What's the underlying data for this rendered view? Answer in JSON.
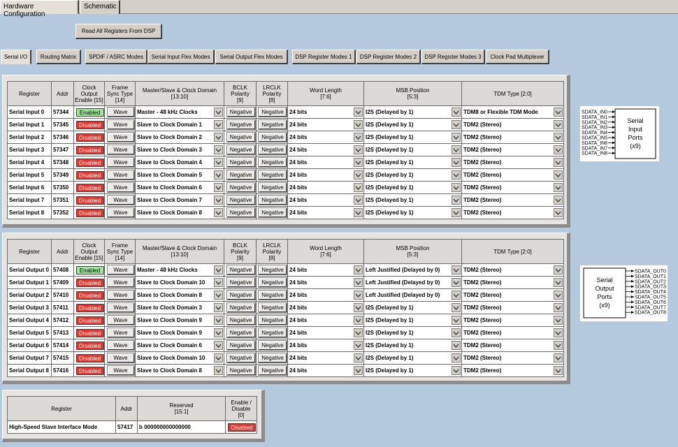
{
  "window": {
    "tabs": [
      {
        "label": "Hardware Configuration",
        "active": true
      },
      {
        "label": "Schematic",
        "active": false
      }
    ],
    "read_button": "Read All Registers From DSP"
  },
  "subtabs": [
    {
      "label": "Serial I/O",
      "active": true
    },
    {
      "label": "Routing Matrix",
      "active": false
    },
    {
      "label": "SPDIF / ASRC Modes",
      "active": false
    },
    {
      "label": "Serial Input Flex Modes",
      "active": false
    },
    {
      "label": "Serial Output Flex Modes",
      "active": false
    },
    {
      "label": "DSP Register Modes 1",
      "active": false
    },
    {
      "label": "DSP Register Modes 2",
      "active": false
    },
    {
      "label": "DSP Register Modes 3",
      "active": false
    },
    {
      "label": "Clock Pad Multiplexer",
      "active": false
    }
  ],
  "columns": {
    "register": "Register",
    "addr": "Addr",
    "clock_enable": [
      "Clock",
      "Output",
      "Enable [15]"
    ],
    "frame_sync": [
      "Frame",
      "Sync Type",
      "[14]"
    ],
    "master_slave": [
      "Master/Slave & Clock Domain",
      "[13:10]"
    ],
    "bclk": [
      "BCLK",
      "Polarity",
      "[9]"
    ],
    "lrclk": [
      "LRCLK",
      "Polarity",
      "[8]"
    ],
    "word_length": [
      "Word Length",
      "[7:6]"
    ],
    "msb": [
      "MSB Position",
      "[5:3]"
    ],
    "tdm": [
      "TDM Type [2:0]"
    ]
  },
  "inputs": [
    {
      "name": "Serial Input 0",
      "addr": "57344",
      "enable": "Enabled",
      "sync": "Wave",
      "domain": "Master - 48 kHz Clocks",
      "bclk": "Negative",
      "lrclk": "Negative",
      "word": "24 bits",
      "msb": "I2S (Delayed by 1)",
      "tdm": "TDM8 or Flexible TDM Mode"
    },
    {
      "name": "Serial Input 1",
      "addr": "57345",
      "enable": "Disabled",
      "sync": "Wave",
      "domain": "Slave to Clock Domain 1",
      "bclk": "Negative",
      "lrclk": "Negative",
      "word": "24 bits",
      "msb": "I2S (Delayed by 1)",
      "tdm": "TDM2 (Stereo)"
    },
    {
      "name": "Serial Input 2",
      "addr": "57346",
      "enable": "Disabled",
      "sync": "Wave",
      "domain": "Slave to Clock Domain 2",
      "bclk": "Negative",
      "lrclk": "Negative",
      "word": "24 bits",
      "msb": "I2S (Delayed by 1)",
      "tdm": "TDM2 (Stereo)"
    },
    {
      "name": "Serial Input 3",
      "addr": "57347",
      "enable": "Disabled",
      "sync": "Wave",
      "domain": "Slave to Clock Domain 3",
      "bclk": "Negative",
      "lrclk": "Negative",
      "word": "24 bits",
      "msb": "I2S (Delayed by 1)",
      "tdm": "TDM2 (Stereo)"
    },
    {
      "name": "Serial Input 4",
      "addr": "57348",
      "enable": "Disabled",
      "sync": "Wave",
      "domain": "Slave to Clock Domain 4",
      "bclk": "Negative",
      "lrclk": "Negative",
      "word": "24 bits",
      "msb": "I2S (Delayed by 1)",
      "tdm": "TDM2 (Stereo)"
    },
    {
      "name": "Serial Input 5",
      "addr": "57349",
      "enable": "Disabled",
      "sync": "Wave",
      "domain": "Slave to Clock Domain 5",
      "bclk": "Negative",
      "lrclk": "Negative",
      "word": "24 bits",
      "msb": "I2S (Delayed by 1)",
      "tdm": "TDM2 (Stereo)"
    },
    {
      "name": "Serial Input 6",
      "addr": "57350",
      "enable": "Disabled",
      "sync": "Wave",
      "domain": "Slave to Clock Domain 6",
      "bclk": "Negative",
      "lrclk": "Negative",
      "word": "24 bits",
      "msb": "I2S (Delayed by 1)",
      "tdm": "TDM2 (Stereo)"
    },
    {
      "name": "Serial Input 7",
      "addr": "57351",
      "enable": "Disabled",
      "sync": "Wave",
      "domain": "Slave to Clock Domain 7",
      "bclk": "Negative",
      "lrclk": "Negative",
      "word": "24 bits",
      "msb": "I2S (Delayed by 1)",
      "tdm": "TDM2 (Stereo)"
    },
    {
      "name": "Serial Input 8",
      "addr": "57352",
      "enable": "Disabled",
      "sync": "Wave",
      "domain": "Slave to Clock Domain 8",
      "bclk": "Negative",
      "lrclk": "Negative",
      "word": "24 bits",
      "msb": "I2S (Delayed by 1)",
      "tdm": "TDM2 (Stereo)"
    }
  ],
  "outputs": [
    {
      "name": "Serial Output 0",
      "addr": "57408",
      "enable": "Enabled",
      "sync": "Wave",
      "domain": "Master - 48 kHz Clocks",
      "bclk": "Negative",
      "lrclk": "Negative",
      "word": "24 bits",
      "msb": "Left Justified (Delayed by 0)",
      "tdm": "TDM2 (Stereo)"
    },
    {
      "name": "Serial Output 1",
      "addr": "57409",
      "enable": "Disabled",
      "sync": "Wave",
      "domain": "Slave to Clock Domain 10",
      "bclk": "Negative",
      "lrclk": "Negative",
      "word": "24 bits",
      "msb": "Left Justified (Delayed by 0)",
      "tdm": "TDM2 (Stereo)"
    },
    {
      "name": "Serial Output 2",
      "addr": "57410",
      "enable": "Disabled",
      "sync": "Wave",
      "domain": "Slave to Clock Domain 8",
      "bclk": "Negative",
      "lrclk": "Negative",
      "word": "24 bits",
      "msb": "Left Justified (Delayed by 0)",
      "tdm": "TDM2 (Stereo)"
    },
    {
      "name": "Serial Output 3",
      "addr": "57411",
      "enable": "Disabled",
      "sync": "Wave",
      "domain": "Slave to Clock Domain 3",
      "bclk": "Negative",
      "lrclk": "Negative",
      "word": "24 bits",
      "msb": "I2S (Delayed by 1)",
      "tdm": "TDM2 (Stereo)"
    },
    {
      "name": "Serial Output 4",
      "addr": "57412",
      "enable": "Disabled",
      "sync": "Wave",
      "domain": "Slave to Clock Domain 9",
      "bclk": "Negative",
      "lrclk": "Negative",
      "word": "24 bits",
      "msb": "I2S (Delayed by 1)",
      "tdm": "TDM2 (Stereo)"
    },
    {
      "name": "Serial Output 5",
      "addr": "57413",
      "enable": "Disabled",
      "sync": "Wave",
      "domain": "Slave to Clock Domain 9",
      "bclk": "Negative",
      "lrclk": "Negative",
      "word": "24 bits",
      "msb": "I2S (Delayed by 1)",
      "tdm": "TDM2 (Stereo)"
    },
    {
      "name": "Serial Output 6",
      "addr": "57414",
      "enable": "Disabled",
      "sync": "Wave",
      "domain": "Slave to Clock Domain 6",
      "bclk": "Negative",
      "lrclk": "Negative",
      "word": "24 bits",
      "msb": "I2S (Delayed by 1)",
      "tdm": "TDM2 (Stereo)"
    },
    {
      "name": "Serial Output 7",
      "addr": "57415",
      "enable": "Disabled",
      "sync": "Wave",
      "domain": "Slave to Clock Domain 10",
      "bclk": "Negative",
      "lrclk": "Negative",
      "word": "24 bits",
      "msb": "I2S (Delayed by 1)",
      "tdm": "TDM2 (Stereo)"
    },
    {
      "name": "Serial Output 8",
      "addr": "57416",
      "enable": "Disabled",
      "sync": "Wave",
      "domain": "Slave to Clock Domain 8",
      "bclk": "Negative",
      "lrclk": "Negative",
      "word": "24 bits",
      "msb": "I2S (Delayed by 1)",
      "tdm": "TDM2 (Stereo)"
    }
  ],
  "hs": {
    "headers": {
      "register": "Register",
      "addr": "Addr",
      "reserved": [
        "Reserved",
        "[15:1]"
      ],
      "enable": [
        "Enable /",
        "Disable",
        "[0]"
      ]
    },
    "row": {
      "name": "High-Speed Slave Interface Mode",
      "addr": "57417",
      "reserved": "b 000000000000000",
      "enable": "Disabled"
    }
  },
  "input_block": {
    "pins": [
      "SDATA_IN0",
      "SDATA_IN1",
      "SDATA_IN2",
      "SDATA_IN3",
      "SDATA_IN4",
      "SDATA_IN5",
      "SDATA_IN6",
      "SDATA_IN7",
      "SDATA_IN8"
    ],
    "label": [
      "Serial",
      "Input",
      "Ports",
      "(x9)"
    ]
  },
  "output_block": {
    "pins": [
      "SDATA_OUT0",
      "SDATA_OUT1",
      "SDATA_OUT2",
      "SDATA_OUT3",
      "SDATA_OUT4",
      "SDATA_OUT5",
      "SDATA_OUT6",
      "SDATA_OUT7",
      "SDATA_OUT8"
    ],
    "label": [
      "Serial",
      "Output",
      "Ports",
      "(x9)"
    ]
  },
  "colors": {
    "enabled": "#9ee69a",
    "disabled": "#e3352d",
    "background": "#b4c8de"
  }
}
